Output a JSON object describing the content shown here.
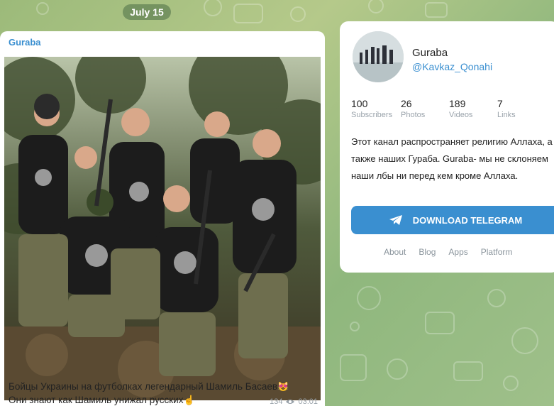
{
  "date_pill": "July 15",
  "message": {
    "author": "Guraba",
    "text_line1": "Бойцы Украины на футболках легендарный Шамиль Басаев",
    "text_line2": "Они знают как Шамиль унижал русских",
    "emoji1": "😻",
    "emoji2": "☝",
    "views": "134",
    "time": "03:01"
  },
  "channel": {
    "name": "Guraba",
    "handle": "@Kavkaz_Qonahi",
    "stats": [
      {
        "value": "100",
        "label": "Subscribers"
      },
      {
        "value": "26",
        "label": "Photos"
      },
      {
        "value": "189",
        "label": "Videos"
      },
      {
        "value": "7",
        "label": "Links"
      }
    ],
    "description": "Этот канал распространяет религию Аллаха, а также наших Гураба. Guraba- мы не склоняем наши лбы ни перед кем кроме Аллаха.",
    "download_label": "DOWNLOAD TELEGRAM",
    "links": [
      "About",
      "Blog",
      "Apps",
      "Platform"
    ]
  },
  "colors": {
    "accent": "#3a8fd0",
    "background": "#9cba7a"
  }
}
